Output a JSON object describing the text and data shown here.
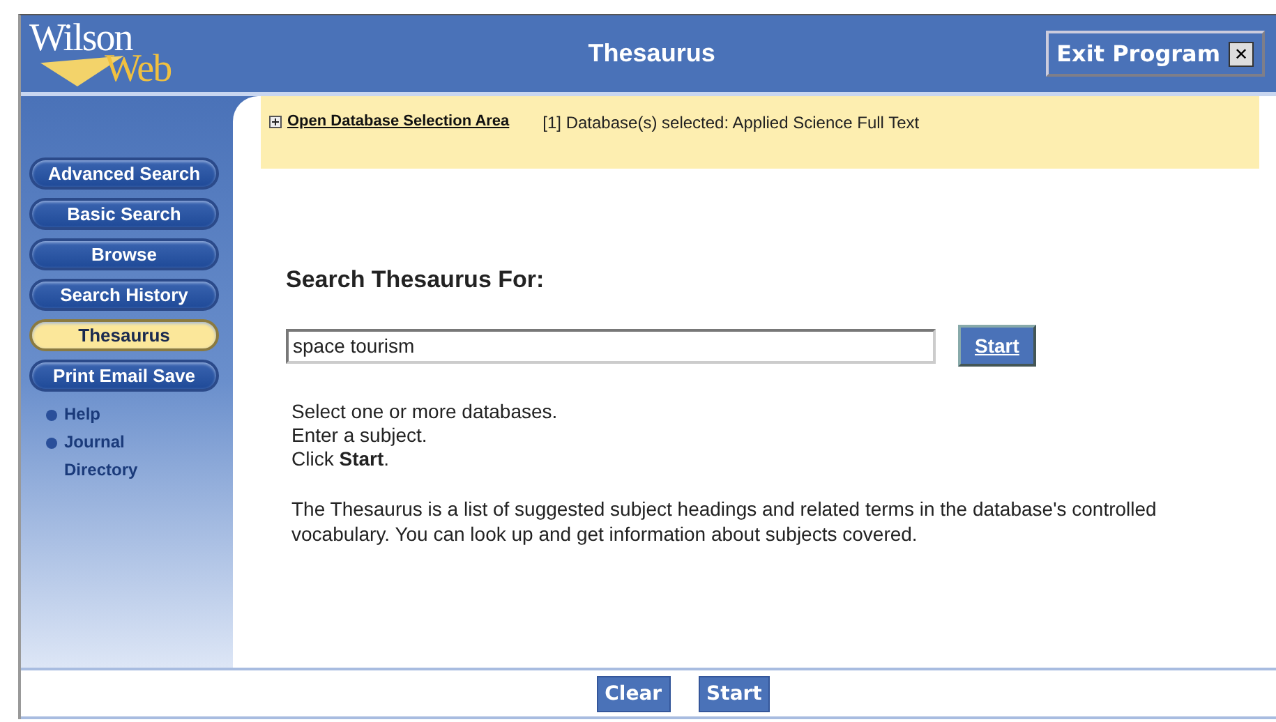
{
  "header": {
    "logo": [
      "Wilson",
      "Web"
    ],
    "title": "Thesaurus",
    "exit_button": {
      "label": "Exit Program",
      "icon": "✕"
    }
  },
  "sidebar": {
    "items": [
      {
        "kind": "button",
        "label": "Advanced Search",
        "selected": false
      },
      {
        "kind": "button",
        "label": "Basic Search",
        "selected": false
      },
      {
        "kind": "button",
        "label": "Browse",
        "selected": false
      },
      {
        "kind": "button",
        "label": "Search History",
        "selected": false
      },
      {
        "kind": "button",
        "label": "Thesaurus",
        "selected": true
      },
      {
        "kind": "button",
        "label": "Print Email Save",
        "selected": false
      },
      {
        "kind": "link",
        "label": "Help",
        "selected": false
      },
      {
        "kind": "link",
        "label": "Journal Directory",
        "selected": false
      }
    ]
  },
  "database_bar": {
    "toggle": "Open Database Selection Area",
    "status": "[1] Database(s) selected: Applied Science Full Text"
  },
  "search": {
    "heading": "Search Thesaurus For:",
    "value": "space tourism",
    "button": "Start"
  },
  "instructions": [
    "Select one or more databases.",
    "Enter a subject.",
    "Click **Start**."
  ],
  "description": "The Thesaurus is a list of suggested subject headings and related terms in the database's controlled vocabulary. You can look up and get information about subjects covered.",
  "footer_buttons": [
    "Clear",
    "Start"
  ]
}
